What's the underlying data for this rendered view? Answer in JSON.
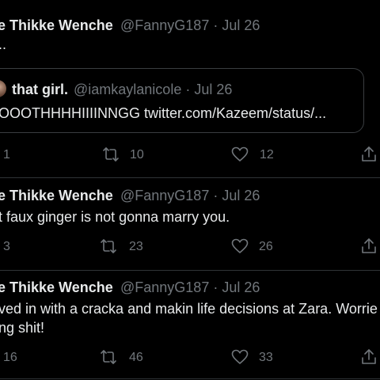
{
  "tweets": [
    {
      "name": "e Thikke Wenche",
      "handle_date": "@FannyG187 · Jul 26",
      "text": "..",
      "quote": {
        "name": "that girl.",
        "handle_date": "@iamkaylanicole · Jul 26",
        "text": "OOOTHHHHIIIINNGG twitter.com/Kazeem/status/..."
      },
      "actions": {
        "reply": "1",
        "retweet": "10",
        "like": "12"
      }
    },
    {
      "name": "e Thikke Wenche",
      "handle_date": "@FannyG187 · Jul 26",
      "text": "t faux ginger is not gonna marry you.",
      "actions": {
        "reply": "3",
        "retweet": "23",
        "like": "26"
      }
    },
    {
      "name": "e Thikke Wenche",
      "handle_date": "@FannyG187 · Jul 26",
      "text_line1": "ved in with a cracka and makin life decisions at Zara. Worrie",
      "text_line2": "ng shit!",
      "actions": {
        "reply": "16",
        "retweet": "46",
        "like": "33"
      }
    }
  ],
  "icons": {
    "reply": "reply-icon",
    "retweet": "retweet-icon",
    "like": "heart-icon",
    "share": "share-icon"
  },
  "colors": {
    "background": "#000000",
    "text": "#e7e9ea",
    "muted": "#71767b",
    "border": "#2f3336"
  }
}
